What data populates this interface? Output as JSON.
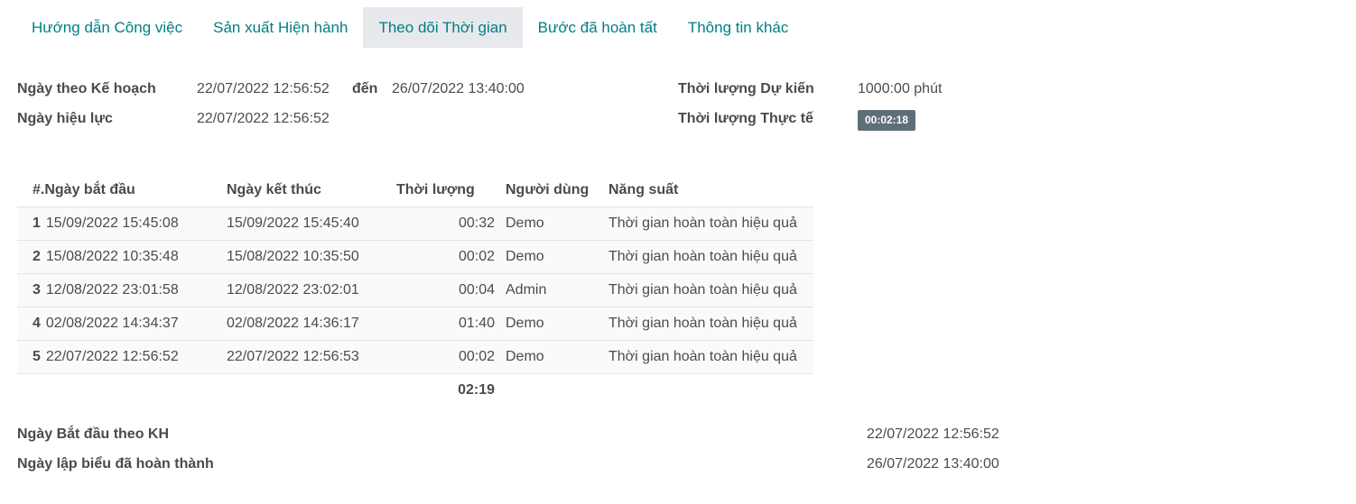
{
  "tabs": [
    {
      "label": "Hướng dẫn Công việc",
      "active": false
    },
    {
      "label": "Sản xuất Hiện hành",
      "active": false
    },
    {
      "label": "Theo dõi Thời gian",
      "active": true
    },
    {
      "label": "Bước đã hoàn tất",
      "active": false
    },
    {
      "label": "Thông tin khác",
      "active": false
    }
  ],
  "info": {
    "planned_label": "Ngày theo Kế hoạch",
    "planned_start": "22/07/2022 12:56:52",
    "to_label": "đến",
    "planned_end": "26/07/2022 13:40:00",
    "effective_label": "Ngày hiệu lực",
    "effective_value": "22/07/2022 12:56:52",
    "expected_duration_label": "Thời lượng Dự kiến",
    "expected_duration_value": "1000:00 phút",
    "real_duration_label": "Thời lượng Thực tế",
    "real_duration_value": "00:02:18"
  },
  "table": {
    "columns": [
      "#.Ngày bắt đầu",
      "Ngày kết thúc",
      "Thời lượng",
      "Người dùng",
      "Năng suất"
    ],
    "rows": [
      {
        "num": "1",
        "start": "15/09/2022 15:45:08",
        "end": "15/09/2022 15:45:40",
        "duration": "00:32",
        "user": "Demo",
        "productivity": "Thời gian hoàn toàn hiệu quả"
      },
      {
        "num": "2",
        "start": "15/08/2022 10:35:48",
        "end": "15/08/2022 10:35:50",
        "duration": "00:02",
        "user": "Demo",
        "productivity": "Thời gian hoàn toàn hiệu quả"
      },
      {
        "num": "3",
        "start": "12/08/2022 23:01:58",
        "end": "12/08/2022 23:02:01",
        "duration": "00:04",
        "user": "Admin",
        "productivity": "Thời gian hoàn toàn hiệu quả"
      },
      {
        "num": "4",
        "start": "02/08/2022 14:34:37",
        "end": "02/08/2022 14:36:17",
        "duration": "01:40",
        "user": "Demo",
        "productivity": "Thời gian hoàn toàn hiệu quả"
      },
      {
        "num": "5",
        "start": "22/07/2022 12:56:52",
        "end": "22/07/2022 12:56:53",
        "duration": "00:02",
        "user": "Demo",
        "productivity": "Thời gian hoàn toàn hiệu quả"
      }
    ],
    "total_duration": "02:19"
  },
  "footer": {
    "planned_start_label": "Ngày Bắt đầu theo KH",
    "planned_start_value": "22/07/2022 12:56:52",
    "sheet_done_label": "Ngày lập biểu đã hoàn thành",
    "sheet_done_value": "26/07/2022 13:40:00"
  }
}
